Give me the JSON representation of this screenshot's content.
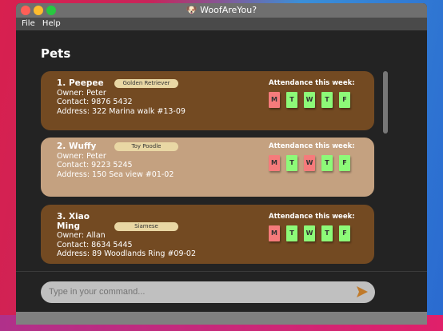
{
  "window": {
    "title": "WoofAreYou?"
  },
  "menu": [
    "File",
    "Help"
  ],
  "page_title": "Pets",
  "attendance_label": "Attendance this week:",
  "pets": [
    {
      "name": "1. Peepee",
      "breed": "Golden Retriever",
      "owner": "Owner: Peter",
      "contact": "Contact: 9876 5432",
      "address": "Address: 322 Marina walk #13-09",
      "color": "#734a22",
      "days": [
        {
          "d": "M",
          "present": false
        },
        {
          "d": "T",
          "present": true
        },
        {
          "d": "W",
          "present": true
        },
        {
          "d": "T",
          "present": true
        },
        {
          "d": "F",
          "present": true
        }
      ]
    },
    {
      "name": "2. Wuffy",
      "breed": "Toy Poodle",
      "owner": "Owner: Peter",
      "contact": "Contact: 9223 5245",
      "address": "Address: 150 Sea view #01-02",
      "color": "#c4a180",
      "days": [
        {
          "d": "M",
          "present": false
        },
        {
          "d": "T",
          "present": true
        },
        {
          "d": "W",
          "present": false
        },
        {
          "d": "T",
          "present": true
        },
        {
          "d": "F",
          "present": true
        }
      ]
    },
    {
      "name": "3. Xiao Ming",
      "breed": "Siamese",
      "owner": "Owner: Allan",
      "contact": "Contact: 8634 5445",
      "address": "Address: 89 Woodlands Ring #09-02",
      "color": "#734a22",
      "days": [
        {
          "d": "M",
          "present": false
        },
        {
          "d": "T",
          "present": true
        },
        {
          "d": "W",
          "present": true
        },
        {
          "d": "T",
          "present": true
        },
        {
          "d": "F",
          "present": true
        }
      ]
    }
  ],
  "command": {
    "placeholder": "Type in your command...",
    "value": ""
  }
}
